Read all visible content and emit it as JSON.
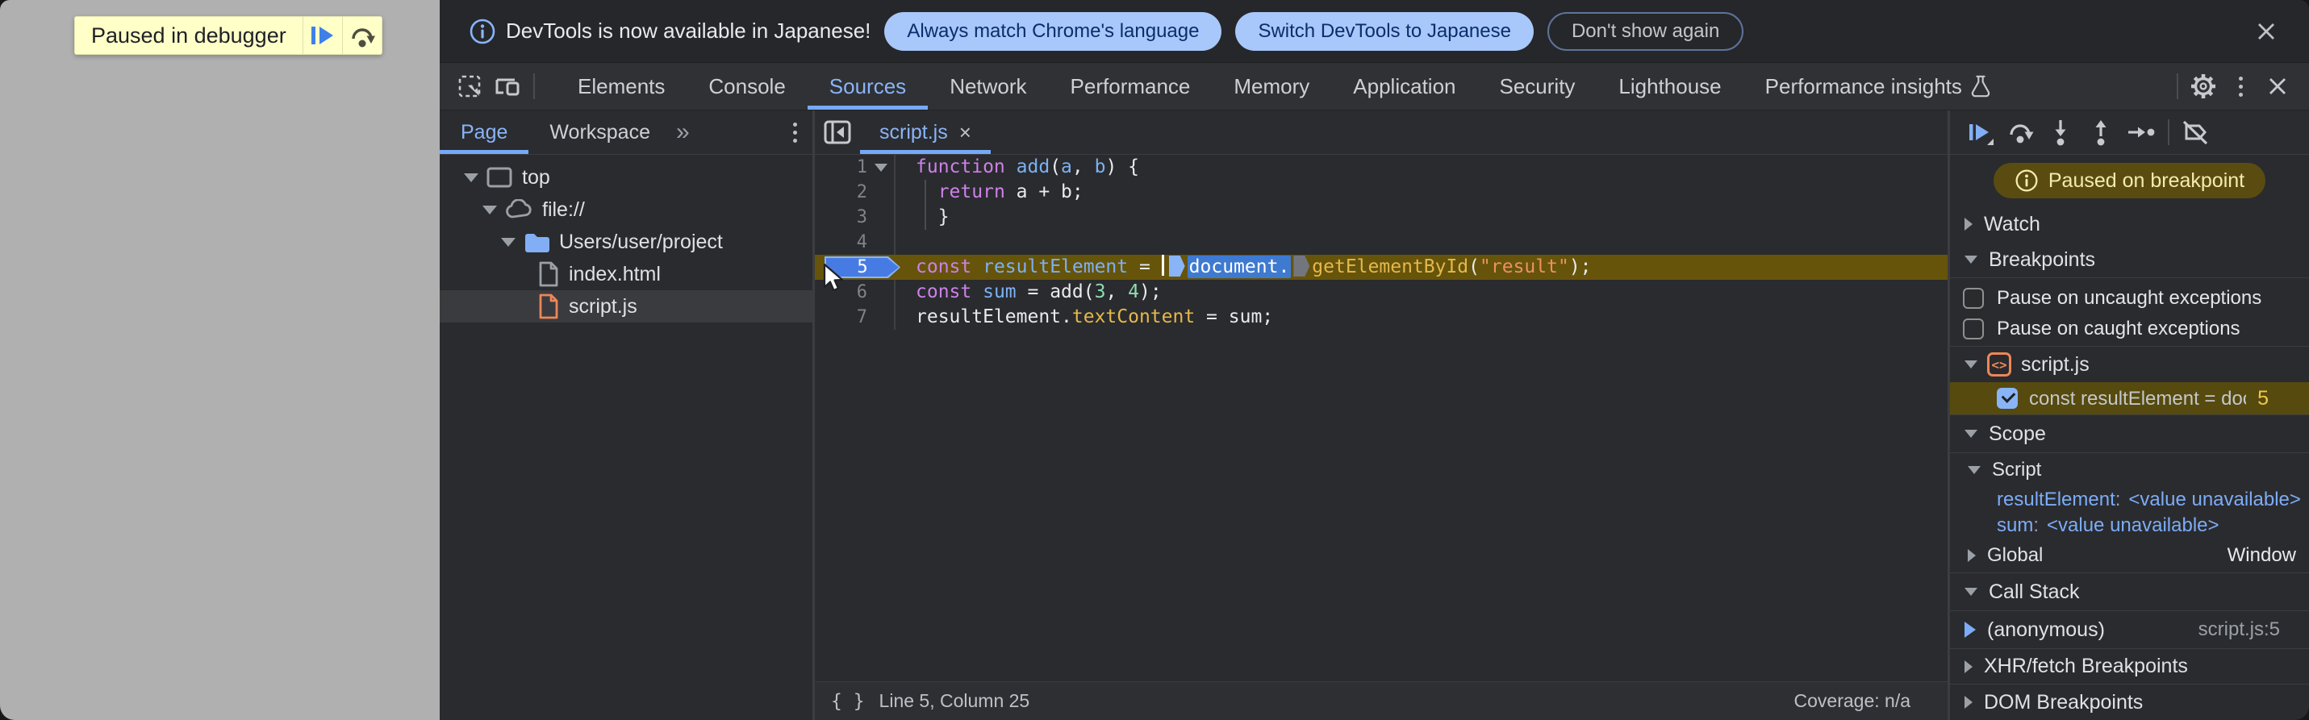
{
  "colors": {
    "accent_blue": "#8ab4f8",
    "notif_pill_bg": "#a8c7fa",
    "notif_pill_text": "#0a2e6c",
    "exec_line_bg": "#66540b",
    "paused_pill_bg": "#5a4c10",
    "paused_pill_text": "#f3ecae",
    "banner_bg": "#ffffc8",
    "string_orange": "#ee8f62",
    "keyword_purple": "#cd81e8",
    "file_icon_orange": "#ec8758"
  },
  "webpage": {
    "paused_banner": {
      "label": "Paused in debugger"
    }
  },
  "notification": {
    "text": "DevTools is now available in Japanese!",
    "actions": [
      {
        "label": "Always match Chrome's language"
      },
      {
        "label": "Switch DevTools to Japanese"
      },
      {
        "label": "Don't show again"
      }
    ]
  },
  "main_tabs": {
    "items": [
      {
        "label": "Elements"
      },
      {
        "label": "Console"
      },
      {
        "label": "Sources"
      },
      {
        "label": "Network"
      },
      {
        "label": "Performance"
      },
      {
        "label": "Memory"
      },
      {
        "label": "Application"
      },
      {
        "label": "Security"
      },
      {
        "label": "Lighthouse"
      },
      {
        "label": "Performance insights"
      }
    ],
    "active": "Sources"
  },
  "navigator": {
    "tabs": [
      {
        "label": "Page"
      },
      {
        "label": "Workspace"
      }
    ],
    "more_tabs": "»",
    "tree": [
      {
        "label": "top"
      },
      {
        "label": "file://"
      },
      {
        "label": "Users/user/project"
      },
      {
        "label": "index.html"
      },
      {
        "label": "script.js"
      }
    ]
  },
  "editor": {
    "tab": {
      "label": "script.js",
      "close": "×"
    },
    "code": [
      {
        "num": "1",
        "tokens": [
          [
            "function",
            "kw"
          ],
          [
            " ",
            ""
          ],
          [
            "add",
            "def"
          ],
          [
            "(",
            ""
          ],
          [
            "a",
            "def"
          ],
          [
            ", ",
            ""
          ],
          [
            "b",
            "def"
          ],
          [
            ") {",
            ""
          ]
        ]
      },
      {
        "num": "2",
        "tokens": [
          [
            "  ",
            ""
          ],
          [
            "return",
            "kw"
          ],
          [
            " a + b;",
            ""
          ]
        ]
      },
      {
        "num": "3",
        "tokens": [
          [
            "  }",
            ""
          ]
        ]
      },
      {
        "num": "4",
        "tokens": []
      },
      {
        "num": "5",
        "tokens": [
          [
            "const",
            "kw"
          ],
          [
            " ",
            ""
          ],
          [
            "resultElement",
            "def"
          ],
          [
            " = ",
            ""
          ],
          [
            "",
            "caret"
          ],
          [
            "",
            "marker marker-blue"
          ],
          [
            "document.",
            "dochl"
          ],
          [
            "",
            "marker marker-gray"
          ],
          [
            "getElementById",
            "prop"
          ],
          [
            "(",
            ""
          ],
          [
            "\"result\"",
            "str"
          ],
          [
            ");",
            ""
          ]
        ]
      },
      {
        "num": "6",
        "tokens": [
          [
            "const",
            "kw"
          ],
          [
            " ",
            ""
          ],
          [
            "sum",
            "def"
          ],
          [
            " = add(",
            ""
          ],
          [
            "3",
            "num"
          ],
          [
            ", ",
            ""
          ],
          [
            "4",
            "num"
          ],
          [
            ");",
            ""
          ]
        ]
      },
      {
        "num": "7",
        "tokens": [
          [
            "resultElement.",
            ""
          ],
          [
            "textContent",
            "prop"
          ],
          [
            " = sum;",
            ""
          ]
        ]
      }
    ],
    "status": {
      "position": "Line 5, Column 25",
      "coverage": "Coverage: n/a"
    }
  },
  "debugger": {
    "paused_message": "Paused on breakpoint",
    "watch": {
      "label": "Watch"
    },
    "breakpoints": {
      "label": "Breakpoints",
      "exceptions": [
        {
          "label": "Pause on uncaught exceptions",
          "checked": false
        },
        {
          "label": "Pause on caught exceptions",
          "checked": false
        }
      ],
      "group": {
        "file": "script.js"
      },
      "item": {
        "snippet": "const resultElement = doc⋯",
        "line": "5",
        "checked": true
      }
    },
    "scope": {
      "label": "Scope",
      "script": {
        "label": "Script",
        "vars": [
          {
            "name": "resultElement",
            "value": "<value unavailable>"
          },
          {
            "name": "sum",
            "value": "<value unavailable>"
          }
        ]
      },
      "global": {
        "label": "Global",
        "value": "Window"
      }
    },
    "call_stack": {
      "label": "Call Stack",
      "frames": [
        {
          "name": "(anonymous)",
          "location": "script.js:5"
        }
      ]
    },
    "xhr_breakpoints": {
      "label": "XHR/fetch Breakpoints"
    },
    "dom_breakpoints": {
      "label": "DOM Breakpoints"
    }
  }
}
